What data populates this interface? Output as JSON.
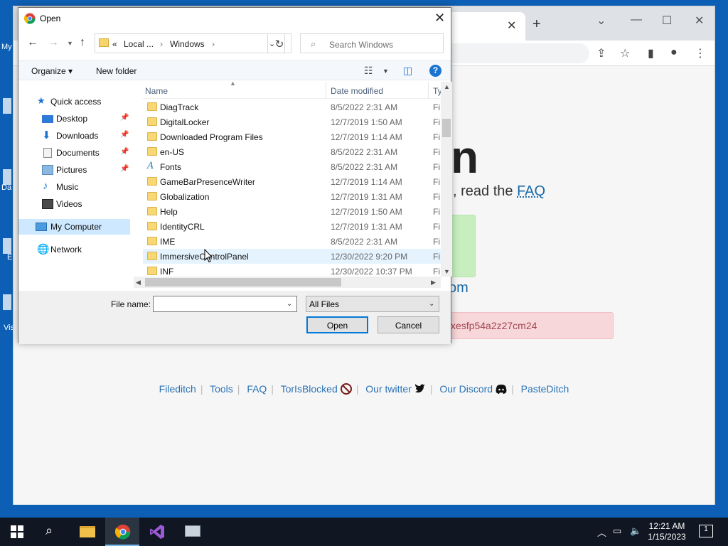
{
  "desktop": {
    "icons": [
      {
        "label": "My"
      },
      {
        "label": "Da"
      },
      {
        "label": "E"
      },
      {
        "label": "Vis"
      }
    ]
  },
  "browser": {
    "page": {
      "big_text": "n",
      "faq_prefix": ", read the ",
      "faq_link": "FAQ",
      "com_text": "om",
      "error_text": "xesfp54a2z27cm24",
      "footer": [
        "Fileditch",
        "Tools",
        "FAQ",
        "TorIsBlocked",
        "Our twitter",
        "Our Discord",
        "PasteDitch"
      ]
    }
  },
  "dialog": {
    "title": "Open",
    "nav": {
      "address": {
        "chevrons": "«",
        "segment1": "Local ...",
        "sep1": "›",
        "segment2": "Windows",
        "sep2": "›"
      },
      "search_placeholder": "Search Windows"
    },
    "commands": {
      "organize": "Organize ▾",
      "new_folder": "New folder",
      "help": "?"
    },
    "nav_pane": [
      {
        "label": "Quick access",
        "icon": "star-icon",
        "pinned": false
      },
      {
        "label": "Desktop",
        "icon": "desktop-icon",
        "pinned": true
      },
      {
        "label": "Downloads",
        "icon": "downloads-icon",
        "pinned": true
      },
      {
        "label": "Documents",
        "icon": "documents-icon",
        "pinned": true
      },
      {
        "label": "Pictures",
        "icon": "pictures-icon",
        "pinned": true
      },
      {
        "label": "Music",
        "icon": "music-icon",
        "pinned": false
      },
      {
        "label": "Videos",
        "icon": "videos-icon",
        "pinned": false
      },
      {
        "label": "My Computer",
        "icon": "computer-icon",
        "pinned": false,
        "selected": true
      },
      {
        "label": "Network",
        "icon": "network-icon",
        "pinned": false
      }
    ],
    "columns": {
      "name": "Name",
      "date": "Date modified",
      "type": "Ty"
    },
    "files": [
      {
        "name": "DiagTrack",
        "date": "8/5/2022 2:31 AM",
        "type": "Fi"
      },
      {
        "name": "DigitalLocker",
        "date": "12/7/2019 1:50 AM",
        "type": "Fi"
      },
      {
        "name": "Downloaded Program Files",
        "date": "12/7/2019 1:14 AM",
        "type": "Fi"
      },
      {
        "name": "en-US",
        "date": "8/5/2022 2:31 AM",
        "type": "Fi"
      },
      {
        "name": "Fonts",
        "date": "8/5/2022 2:31 AM",
        "type": "Fi",
        "icon": "font"
      },
      {
        "name": "GameBarPresenceWriter",
        "date": "12/7/2019 1:14 AM",
        "type": "Fi"
      },
      {
        "name": "Globalization",
        "date": "12/7/2019 1:31 AM",
        "type": "Fi"
      },
      {
        "name": "Help",
        "date": "12/7/2019 1:50 AM",
        "type": "Fi"
      },
      {
        "name": "IdentityCRL",
        "date": "12/7/2019 1:31 AM",
        "type": "Fi"
      },
      {
        "name": "IME",
        "date": "8/5/2022 2:31 AM",
        "type": "Fi"
      },
      {
        "name": "ImmersiveControlPanel",
        "date": "12/30/2022 9:20 PM",
        "type": "Fi",
        "hover": true
      },
      {
        "name": "INF",
        "date": "12/30/2022 10:37 PM",
        "type": "Fi"
      }
    ],
    "bottom": {
      "file_name_label": "File name:",
      "file_name_value": "",
      "file_type": "All Files",
      "open_label": "Open",
      "cancel_label": "Cancel"
    }
  },
  "taskbar": {
    "apps": [
      "start",
      "search",
      "file-explorer",
      "chrome",
      "visual-studio",
      "remote-desktop"
    ],
    "active_app": "chrome",
    "time": "12:21 AM",
    "date": "1/15/2023",
    "notifications": "1"
  },
  "colors": {
    "accent": "#0078d7",
    "selection": "#cde8ff",
    "hover": "#e5f3ff",
    "taskbar": "#101722"
  }
}
